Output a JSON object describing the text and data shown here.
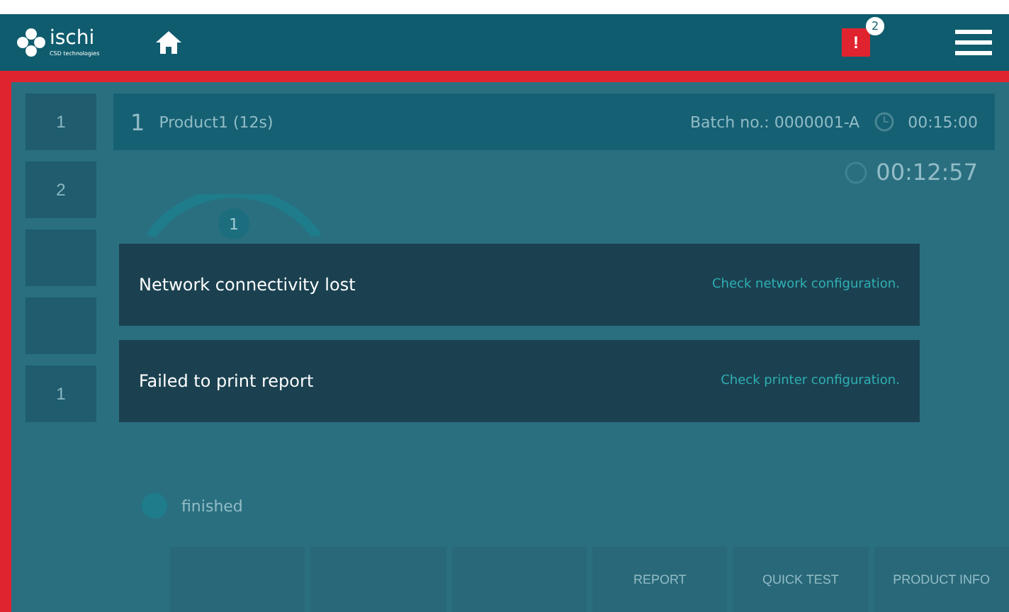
{
  "topbar": {
    "logo": "ischi",
    "logo_sub": "CSD technologies",
    "alert_mark": "!",
    "alert_count": "2"
  },
  "side_tabs": [
    {
      "kind": "numbered",
      "label": "1"
    },
    {
      "kind": "numbered",
      "label": "2"
    },
    {
      "kind": "empty"
    },
    {
      "kind": "empty"
    },
    {
      "kind": "numbered",
      "label": "1"
    }
  ],
  "product": {
    "number": "1",
    "name": "Product1 (12s)",
    "batch": "Batch no.: 0000001-A",
    "time": "00:15:00"
  },
  "timer": "00:12:57",
  "dial_number": "1",
  "status": "finished",
  "bottom_buttons": [
    {
      "kind": "empty"
    },
    {
      "kind": "empty"
    },
    {
      "kind": "empty"
    },
    {
      "kind": "text",
      "label": "REPORT"
    },
    {
      "kind": "text",
      "label": "QUICK TEST"
    },
    {
      "kind": "text",
      "label": "PRODUCT INFO"
    }
  ],
  "notifications": [
    {
      "message": "Network connectivity lost",
      "action": "Check network configuration."
    },
    {
      "message": "Failed to print report",
      "action": "Check printer configuration."
    }
  ]
}
